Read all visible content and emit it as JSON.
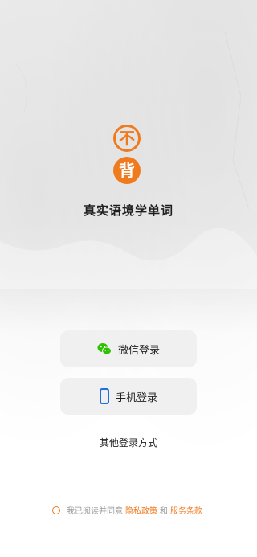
{
  "logo": {
    "top_char": "不",
    "bottom_char": "背"
  },
  "tagline": "真实语境学单词",
  "buttons": {
    "wechat_label": "微信登录",
    "phone_label": "手机登录"
  },
  "other_login": "其他登录方式",
  "agreement": {
    "prefix": "我已阅读并同意",
    "privacy_link": "隐私政策",
    "and": "和",
    "service_link": "服务条款"
  },
  "colors": {
    "brand": "#f07a1e",
    "wechat": "#2dc100",
    "phone_icon": "#1e6fe0"
  },
  "icons": {
    "wechat": "wechat-icon",
    "phone": "phone-icon",
    "radio": "radio-unchecked-icon"
  }
}
